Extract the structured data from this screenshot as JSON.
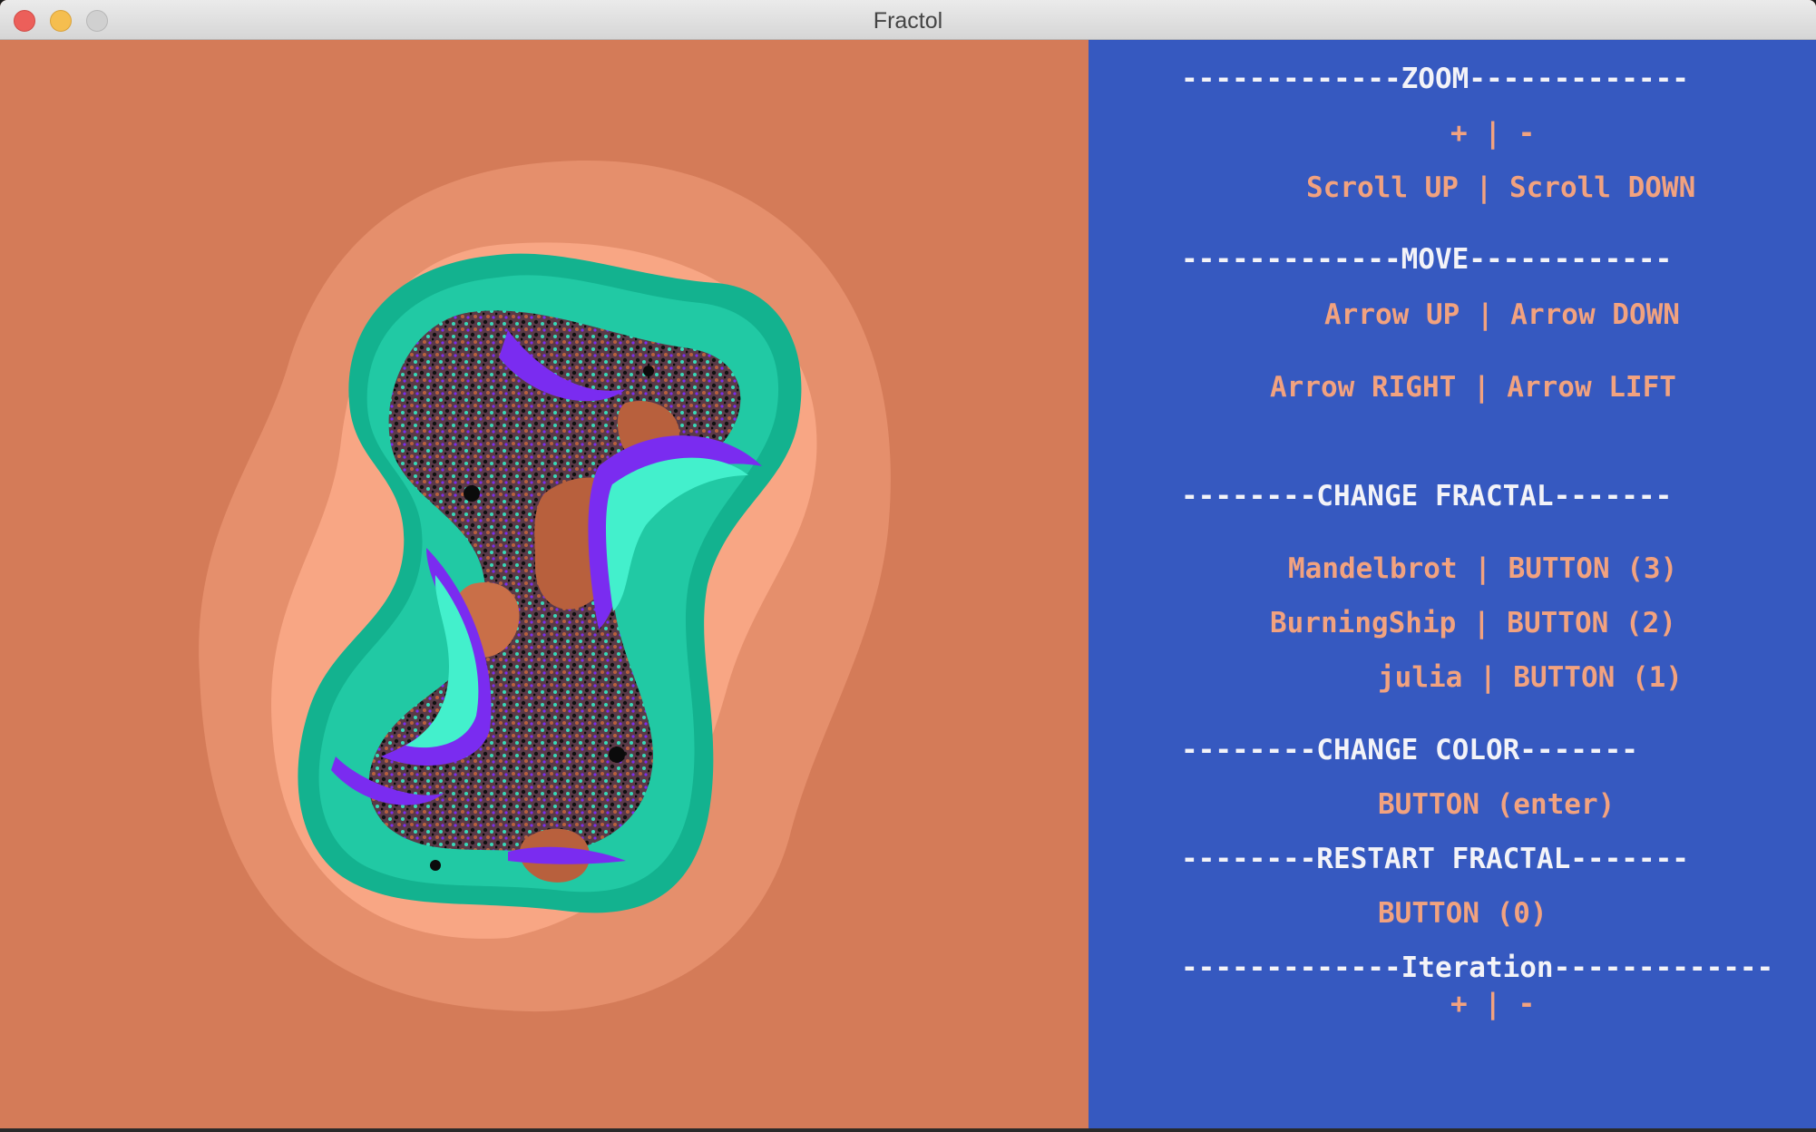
{
  "window": {
    "title": "Fractol"
  },
  "colors": {
    "background": "#d47b58",
    "panel": "#3659c0",
    "heading_text": "#f3f3f8",
    "key_text": "#f2a27f",
    "fractal_teal": "#38d9b8",
    "fractal_purple": "#7a2cf0",
    "fractal_brown": "#b8603d"
  },
  "panel": {
    "zoom_header": "-------------ZOOM-------------",
    "zoom_keys": "+ | -",
    "zoom_scroll": "Scroll UP | Scroll DOWN",
    "move_header": "-------------MOVE------------",
    "move_updown": "Arrow UP | Arrow DOWN",
    "move_leftright": "Arrow RIGHT | Arrow LIFT",
    "change_fractal_header": "--------CHANGE FRACTAL-------",
    "fractal_mandelbrot": "Mandelbrot | BUTTON (3)",
    "fractal_burningship": "BurningShip | BUTTON (2)",
    "fractal_julia": "julia | BUTTON (1)",
    "change_color_header": "--------CHANGE COLOR-------",
    "change_color_key": "BUTTON (enter)",
    "restart_header": "--------RESTART FRACTAL-------",
    "restart_key": "BUTTON (0)",
    "iteration_header": "-------------Iteration-------------",
    "iteration_keys": "+ | -"
  }
}
